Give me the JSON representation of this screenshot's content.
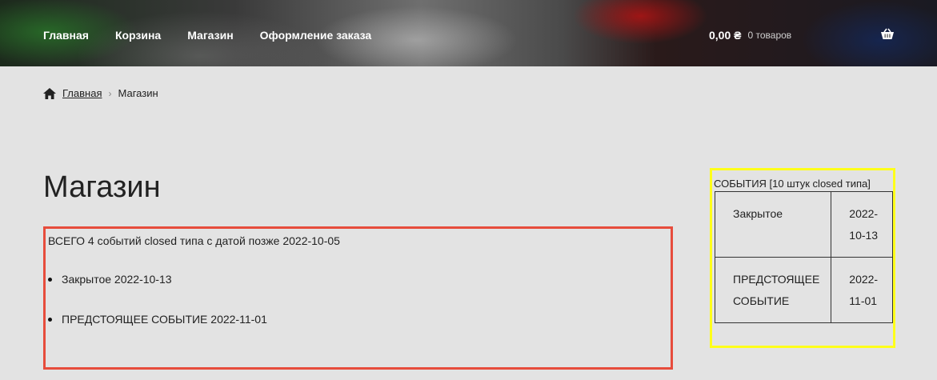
{
  "header": {
    "nav": [
      "Главная",
      "Корзина",
      "Магазин",
      "Оформление заказа"
    ],
    "cart_amount": "0,00 ₴",
    "cart_count": "0 товаров",
    "cart_icon": "basket-icon"
  },
  "breadcrumb": {
    "home_icon": "home-icon",
    "home": "Главная",
    "current": "Магазин"
  },
  "page_title": "Магазин",
  "closed_events": {
    "summary": "ВСЕГО 4 событий closed типа с датой позже 2022-10-05",
    "items": [
      "Закрытое 2022-10-13",
      "ПРЕДСТОЯЩЕЕ СОБЫТИЕ 2022-11-01"
    ]
  },
  "sidebar_events": {
    "caption": "СОБЫТИЯ [10 штук closed типа]",
    "rows": [
      {
        "name": "Закрытое",
        "date": "2022-10-13"
      },
      {
        "name": "ПРЕДСТОЯЩЕЕ СОБЫТИЕ",
        "date": "2022-11-01"
      }
    ]
  },
  "colors": {
    "red_box": "#e74c3c",
    "yellow_box": "#ffff1a"
  }
}
